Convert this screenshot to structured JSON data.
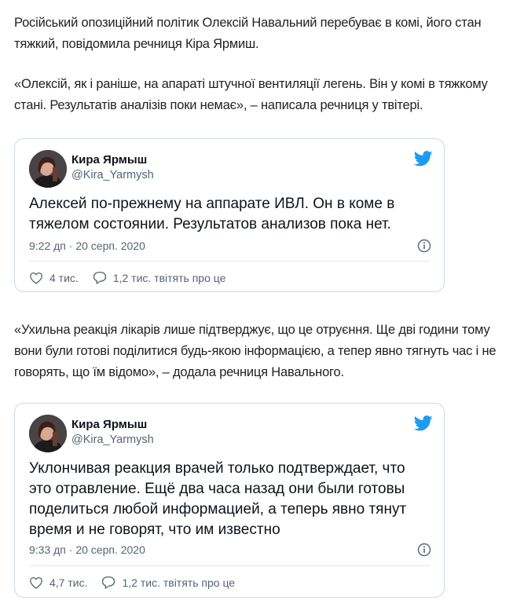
{
  "paragraphs": {
    "p1": "Російський опозиційний політик Олексій Навальний перебуває в комі, його стан тяжкий, повідомила речниця Кіра Ярмиш.",
    "p2": "«Олексій, як і раніше, на апараті штучної вентиляції легень. Він у комі в тяжкому стані. Результатів аналізів поки немає», – написала речниця у твітері.",
    "p3": "«Ухильна реакція лікарів лише підтверджує, що це отруєння. Ще дві години тому вони були готові поділитися будь-якою інформацією, а тепер явно тягнуть час і не говорять, що їм відомо», – додала речниця Навального."
  },
  "tweets": [
    {
      "name": "Кира Ярмыш",
      "handle": "@Kira_Yarmysh",
      "text": "Алексей по-прежнему на аппарате ИВЛ. Он в коме в тяжелом состоянии. Результатов анализов пока нет.",
      "time": "9:22 дп · 20 серп. 2020",
      "likes": "4 тис.",
      "replies": "1,2 тис. твітять про це"
    },
    {
      "name": "Кира Ярмыш",
      "handle": "@Kira_Yarmysh",
      "text": "Уклончивая реакция врачей только подтверждает, что это отравление. Ещё два часа назад они были готовы поделиться любой информацией, а теперь явно тянут время и не говорят, что им известно",
      "time": "9:33 дп · 20 серп. 2020",
      "likes": "4,7 тис.",
      "replies": "1,2 тис. твітять про це"
    }
  ],
  "icons": {
    "twitter_bird": "twitter-bird-icon",
    "info": "info-icon",
    "heart": "heart-icon",
    "reply": "reply-bubble-icon"
  },
  "colors": {
    "twitter_blue": "#1d9bf0",
    "muted": "#536471",
    "border": "#cfd9de"
  }
}
